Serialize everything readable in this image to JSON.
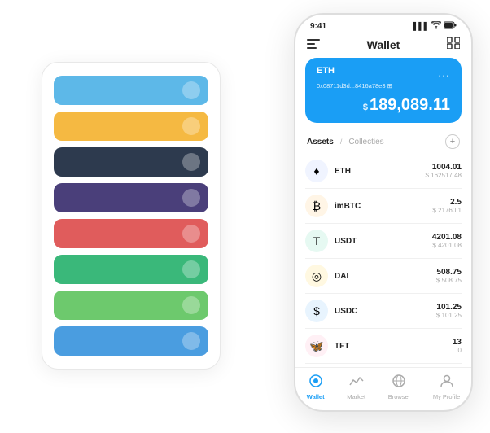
{
  "scene": {
    "cards": [
      {
        "color": "#5db8e8",
        "icon": "◈"
      },
      {
        "color": "#f5b942",
        "icon": "◈"
      },
      {
        "color": "#2d3a4e",
        "icon": "◈"
      },
      {
        "color": "#4a3f7a",
        "icon": "◈"
      },
      {
        "color": "#e05c5c",
        "icon": "◈"
      },
      {
        "color": "#3ab87a",
        "icon": "◈"
      },
      {
        "color": "#6dc96d",
        "icon": "◈"
      },
      {
        "color": "#4a9de0",
        "icon": "◈"
      }
    ]
  },
  "phone": {
    "status_bar": {
      "time": "9:41",
      "signal": "▌▌▌",
      "wifi": "wifi",
      "battery": "▓"
    },
    "header": {
      "menu_label": "≡",
      "title": "Wallet",
      "expand_label": "⛶"
    },
    "eth_card": {
      "label": "ETH",
      "address": "0x08711d3d...8416a78e3  ⊞",
      "more": "...",
      "currency_symbol": "$",
      "amount": "189,089.11"
    },
    "assets": {
      "tab_active": "Assets",
      "divider": "/",
      "tab_inactive": "Collecties",
      "add_icon": "+"
    },
    "asset_list": [
      {
        "name": "ETH",
        "icon": "♦",
        "icon_class": "icon-eth",
        "amount": "1004.01",
        "usd": "$ 162517.48"
      },
      {
        "name": "imBTC",
        "icon": "₿",
        "icon_class": "icon-imbtc",
        "amount": "2.5",
        "usd": "$ 21760.1"
      },
      {
        "name": "USDT",
        "icon": "T",
        "icon_class": "icon-usdt",
        "amount": "4201.08",
        "usd": "$ 4201.08"
      },
      {
        "name": "DAI",
        "icon": "◎",
        "icon_class": "icon-dai",
        "amount": "508.75",
        "usd": "$ 508.75"
      },
      {
        "name": "USDC",
        "icon": "$",
        "icon_class": "icon-usdc",
        "amount": "101.25",
        "usd": "$ 101.25"
      },
      {
        "name": "TFT",
        "icon": "🦋",
        "icon_class": "icon-tft",
        "amount": "13",
        "usd": "0"
      }
    ],
    "nav": [
      {
        "icon": "◉",
        "label": "Wallet",
        "active": true
      },
      {
        "icon": "📈",
        "label": "Market",
        "active": false
      },
      {
        "icon": "🌐",
        "label": "Browser",
        "active": false
      },
      {
        "icon": "👤",
        "label": "My Profile",
        "active": false
      }
    ]
  }
}
